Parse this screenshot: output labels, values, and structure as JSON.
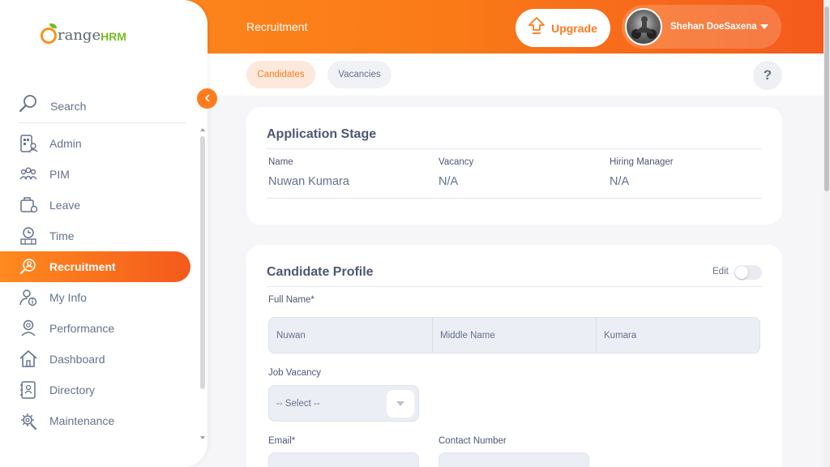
{
  "header": {
    "title": "Recruitment",
    "upgrade_label": "Upgrade",
    "user_name": "Shehan DoeSaxena"
  },
  "tabs": [
    {
      "label": "Candidates",
      "active": true
    },
    {
      "label": "Vacancies",
      "active": false
    }
  ],
  "help_label": "?",
  "logo": {
    "prefix": "range",
    "suffix": "HRM"
  },
  "sidebar": {
    "search_label": "Search",
    "items": [
      {
        "label": "Admin",
        "icon": "admin-icon"
      },
      {
        "label": "PIM",
        "icon": "pim-icon"
      },
      {
        "label": "Leave",
        "icon": "leave-icon"
      },
      {
        "label": "Time",
        "icon": "time-icon"
      },
      {
        "label": "Recruitment",
        "icon": "recruitment-icon",
        "active": true
      },
      {
        "label": "My Info",
        "icon": "my-info-icon"
      },
      {
        "label": "Performance",
        "icon": "performance-icon"
      },
      {
        "label": "Dashboard",
        "icon": "dashboard-icon"
      },
      {
        "label": "Directory",
        "icon": "directory-icon"
      },
      {
        "label": "Maintenance",
        "icon": "maintenance-icon"
      }
    ]
  },
  "application_stage": {
    "title": "Application Stage",
    "name_label": "Name",
    "name_value": "Nuwan Kumara",
    "vacancy_label": "Vacancy",
    "vacancy_value": "N/A",
    "manager_label": "Hiring Manager",
    "manager_value": "N/A"
  },
  "candidate_profile": {
    "title": "Candidate Profile",
    "edit_label": "Edit",
    "edit_enabled": false,
    "full_name_label": "Full Name*",
    "first_name": "Nuwan",
    "middle_name_placeholder": "Middle Name",
    "last_name": "Kumara",
    "job_vacancy_label": "Job Vacancy",
    "job_vacancy_value": "-- Select --",
    "email_label": "Email*",
    "contact_label": "Contact Number"
  },
  "colors": {
    "accent": "#ff7b1d",
    "header_start": "#ff8a1e",
    "header_end": "#f45a1c",
    "text": "#64728c",
    "heading": "#4c5773"
  }
}
